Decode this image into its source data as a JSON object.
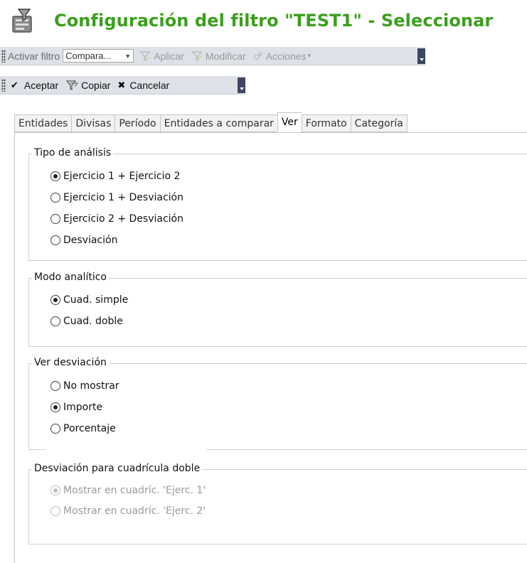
{
  "window": {
    "title": "Configuración del filtro \"TEST1\" - Seleccionar",
    "icon": "filter-settings-icon"
  },
  "toolbar1": {
    "activate_label": "Activar filtro",
    "combo_value": "Compara...",
    "apply_label": "Aplicar",
    "modify_label": "Modificar",
    "actions_label": "Acciones"
  },
  "toolbar2": {
    "accept_label": "Aceptar",
    "copy_label": "Copiar",
    "cancel_label": "Cancelar"
  },
  "tabs": [
    {
      "label": "Entidades"
    },
    {
      "label": "Divisas"
    },
    {
      "label": "Período"
    },
    {
      "label": "Entidades a comparar"
    },
    {
      "label": "Ver",
      "selected": true
    },
    {
      "label": "Formato"
    },
    {
      "label": "Categoría"
    }
  ],
  "groups": {
    "analysis_type": {
      "legend": "Tipo de análisis",
      "options": [
        "Ejercicio 1 + Ejercicio 2",
        "Ejercicio 1 + Desviación",
        "Ejercicio 2 + Desviación",
        "Desviación"
      ],
      "selected": "Ejercicio 1 + Ejercicio 2"
    },
    "analytic_mode": {
      "legend": "Modo analítico",
      "options": [
        "Cuad. simple",
        "Cuad. doble"
      ],
      "selected": "Cuad. simple"
    },
    "show_deviation": {
      "legend": "Ver desviación",
      "options": [
        "No mostrar",
        "Importe",
        "Porcentaje"
      ],
      "selected": "Importe"
    },
    "double_grid_deviation": {
      "legend": "Desviación para cuadrícula doble",
      "options": [
        "Mostrar en cuadríc. 'Ejerc. 1'",
        "Mostrar en cuadríc. 'Ejerc. 2'"
      ],
      "selected": "Mostrar en cuadríc. 'Ejerc. 1'",
      "disabled": true
    }
  },
  "colors": {
    "title": "#3a9f1c",
    "toolbar_bg": "#dfe1e8",
    "toolbar_end": "#3c4660"
  }
}
